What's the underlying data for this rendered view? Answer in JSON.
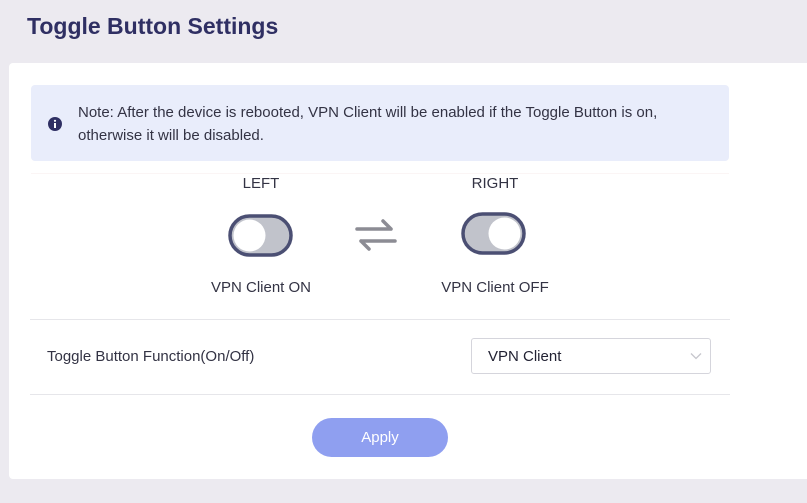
{
  "page": {
    "title": "Toggle Button Settings"
  },
  "note": {
    "icon": "info-icon",
    "text": "Note: After the device is rebooted, VPN Client will be enabled if the Toggle Button is on, otherwise it will be disabled."
  },
  "diagram": {
    "left": {
      "position_label": "LEFT",
      "state_label": "VPN Client ON",
      "icon": "toggle-left-icon"
    },
    "right": {
      "position_label": "RIGHT",
      "state_label": "VPN Client OFF",
      "icon": "toggle-right-icon"
    },
    "swap_icon": "swap-arrows-icon"
  },
  "function_row": {
    "label": "Toggle Button Function(On/Off)",
    "selected": "VPN Client",
    "chevron_icon": "chevron-down-icon"
  },
  "apply_label": "Apply",
  "colors": {
    "title": "#2f2f63",
    "note_bg": "#e9edfb",
    "toggle_track": "#c1c3cb",
    "toggle_border": "#4b4f73",
    "apply_bg": "#8f9ff0"
  }
}
